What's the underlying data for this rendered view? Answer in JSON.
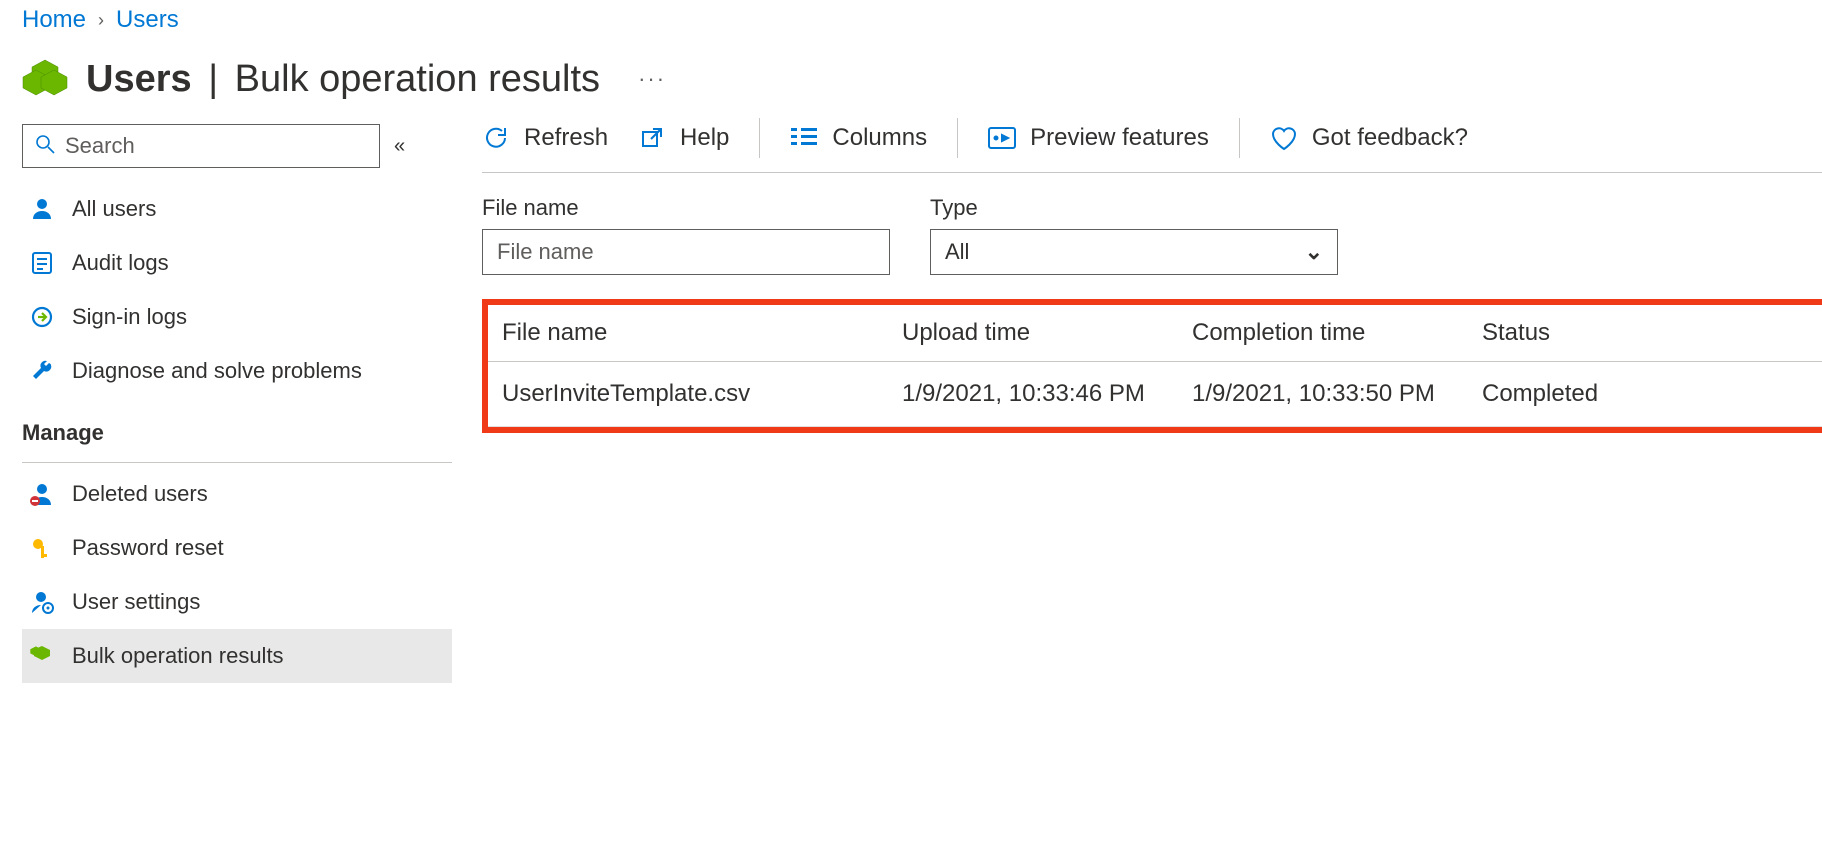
{
  "breadcrumb": {
    "home": "Home",
    "users": "Users"
  },
  "title": {
    "strong": "Users",
    "rest": "Bulk operation results",
    "pipe": "|",
    "more": "···"
  },
  "search": {
    "placeholder": "Search"
  },
  "nav": {
    "all_users": "All users",
    "audit_logs": "Audit logs",
    "signin_logs": "Sign-in logs",
    "diagnose": "Diagnose and solve problems",
    "section_manage": "Manage",
    "deleted_users": "Deleted users",
    "password_reset": "Password reset",
    "user_settings": "User settings",
    "bulk_results": "Bulk operation results"
  },
  "toolbar": {
    "refresh": "Refresh",
    "help": "Help",
    "columns": "Columns",
    "preview": "Preview features",
    "feedback": "Got feedback?"
  },
  "filters": {
    "file_label": "File name",
    "file_placeholder": "File name",
    "type_label": "Type",
    "type_value": "All"
  },
  "table": {
    "headers": {
      "file": "File name",
      "upload": "Upload time",
      "complete": "Completion time",
      "status": "Status"
    },
    "rows": [
      {
        "file": "UserInviteTemplate.csv",
        "upload": "1/9/2021, 10:33:46 PM",
        "complete": "1/9/2021, 10:33:50 PM",
        "status": "Completed"
      }
    ]
  }
}
